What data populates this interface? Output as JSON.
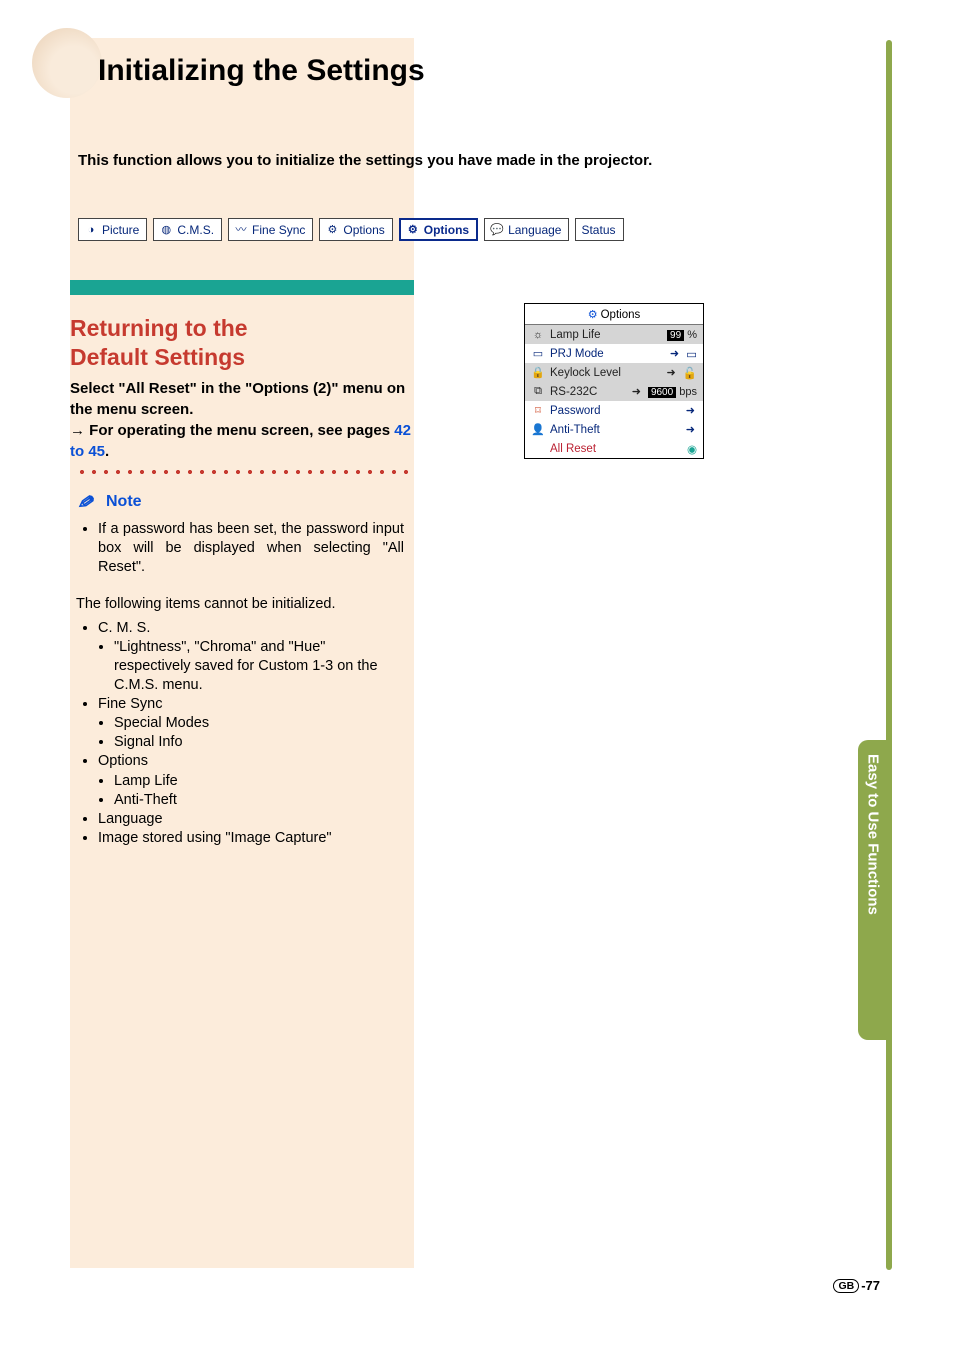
{
  "page": {
    "title": "Initializing the Settings",
    "intro": "This function allows you to initialize the settings you have made in the projector.",
    "region_code": "GB",
    "page_number": "-77"
  },
  "tabs": [
    {
      "icon": "◑",
      "label": "Picture",
      "selected": false
    },
    {
      "icon": "◍",
      "label": "C.M.S.",
      "selected": false
    },
    {
      "icon": "〰",
      "label": "Fine Sync",
      "selected": false
    },
    {
      "icon": "⚙",
      "label": "Options",
      "selected": false
    },
    {
      "icon": "⚙",
      "label": "Options",
      "selected": true
    },
    {
      "icon": "💬",
      "label": "Language",
      "selected": false
    },
    {
      "icon": "",
      "label": "Status",
      "selected": false
    }
  ],
  "section": {
    "title_line1": "Returning to the",
    "title_line2": "Default Settings",
    "instruction_1": "Select \"All Reset\" in the \"Options (2)\" menu on the menu screen.",
    "instruction_2_pre": "→ For operating the menu screen, see pages ",
    "instruction_2_link": "42 to 45",
    "instruction_2_post": "."
  },
  "note": {
    "label": "Note",
    "bullet1": "If a password has been set, the password input box will be displayed when selecting \"All Reset\".",
    "sub_para": "The following items cannot be initialized.",
    "items": [
      {
        "label": "C. M. S.",
        "sub": [
          "\"Lightness\", \"Chroma\" and \"Hue\" respectively  saved for Custom 1-3 on the C.M.S. menu."
        ]
      },
      {
        "label": "Fine Sync",
        "sub": [
          "Special Modes",
          "Signal Info"
        ]
      },
      {
        "label": "Options",
        "sub": [
          "Lamp Life",
          "Anti-Theft"
        ]
      },
      {
        "label": "Language",
        "sub": []
      },
      {
        "label": "Image stored using \"Image Capture\"",
        "sub": []
      }
    ]
  },
  "osd": {
    "title": "Options",
    "rows": {
      "lamp_life": {
        "icon": "☼",
        "label": "Lamp Life",
        "value": "99",
        "unit": "%"
      },
      "prj_mode": {
        "icon": "▭",
        "label": "PRJ Mode"
      },
      "keylock": {
        "icon": "🔒",
        "label": "Keylock Level"
      },
      "rs232c": {
        "icon": "⧉",
        "label": "RS-232C",
        "value": "9600",
        "unit": "bps"
      },
      "password": {
        "icon": "⌑",
        "label": "Password"
      },
      "antitheft": {
        "icon": "👤",
        "label": "Anti-Theft"
      },
      "all_reset": {
        "label": "All Reset"
      }
    }
  },
  "side_tab": "Easy to Use Functions"
}
